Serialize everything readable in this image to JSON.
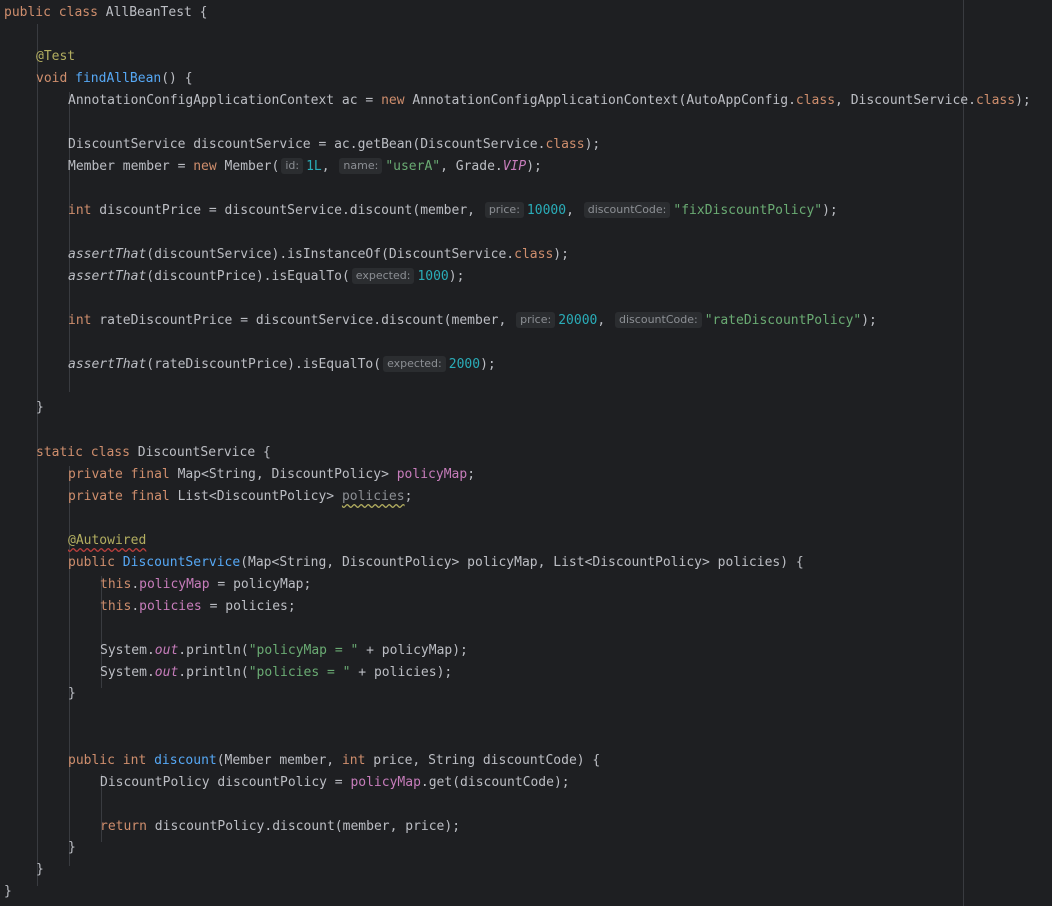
{
  "code": {
    "l1_kw": "public class",
    "l1_name": "AllBeanTest {",
    "l3_ann": "@Test",
    "l4_kw": "void",
    "l4_fn": "findAllBean",
    "l4_rest": "() {",
    "l5_a": "AnnotationConfigApplicationContext ac = ",
    "l5_new": "new",
    "l5_b": " AnnotationConfigApplicationContext(AutoAppConfig.",
    "l5_class1": "class",
    "l5_c": ", DiscountService.",
    "l5_class2": "class",
    "l5_d": ");",
    "l7_a": "DiscountService discountService = ac.getBean(DiscountService.",
    "l7_class": "class",
    "l7_b": ");",
    "l8_a": "Member member = ",
    "l8_new": "new",
    "l8_b": " Member(",
    "l8_hint_id": "id:",
    "l8_id": "1L",
    "l8_comma1": ", ",
    "l8_hint_name": "name:",
    "l8_name": "\"userA\"",
    "l8_c": ", Grade.",
    "l8_vip": "VIP",
    "l8_d": ");",
    "l10_int": "int",
    "l10_a": " discountPrice = discountService.discount(member, ",
    "l10_hint_price": "price:",
    "l10_price": "10000",
    "l10_comma": ", ",
    "l10_hint_code": "discountCode:",
    "l10_code": "\"fixDiscountPolicy\"",
    "l10_b": ");",
    "l12_assert": "assertThat",
    "l12_a": "(discountService).isInstanceOf(DiscountService.",
    "l12_class": "class",
    "l12_b": ");",
    "l13_assert": "assertThat",
    "l13_a": "(discountPrice).isEqualTo(",
    "l13_hint": "expected:",
    "l13_val": "1000",
    "l13_b": ");",
    "l15_int": "int",
    "l15_a": " rateDiscountPrice = discountService.discount(member, ",
    "l15_hint_price": "price:",
    "l15_price": "20000",
    "l15_comma": ", ",
    "l15_hint_code": "discountCode:",
    "l15_code": "\"rateDiscountPolicy\"",
    "l15_b": ");",
    "l17_assert": "assertThat",
    "l17_a": "(rateDiscountPrice).isEqualTo(",
    "l17_hint": "expected:",
    "l17_val": "2000",
    "l17_b": ");",
    "l19": "}",
    "l21_kw": "static class",
    "l21_name": " DiscountService {",
    "l22_kw": "private final",
    "l22_a": " Map<String, DiscountPolicy> ",
    "l22_field": "policyMap",
    "l22_b": ";",
    "l23_kw": "private final",
    "l23_a": " List<DiscountPolicy> ",
    "l23_field": "policies",
    "l23_b": ";",
    "l25_ann": "@Autowired",
    "l26_kw": "public",
    "l26_fn": "DiscountService",
    "l26_a": "(Map<String, DiscountPolicy> policyMap, List<DiscountPolicy> policies) {",
    "l27_this": "this",
    "l27_dot": ".",
    "l27_field": "policyMap",
    "l27_a": " = policyMap;",
    "l28_this": "this",
    "l28_dot": ".",
    "l28_field": "policies",
    "l28_a": " = policies;",
    "l30_a": "System.",
    "l30_out": "out",
    "l30_b": ".println(",
    "l30_str": "\"policyMap = \"",
    "l30_c": " + policyMap);",
    "l31_a": "System.",
    "l31_out": "out",
    "l31_b": ".println(",
    "l31_str": "\"policies = \"",
    "l31_c": " + policies);",
    "l32": "}",
    "l35_kw": "public",
    "l35_int": "int",
    "l35_fn": "discount",
    "l35_a": "(Member member, ",
    "l35_int2": "int",
    "l35_b": " price, String discountCode) {",
    "l36_a": "DiscountPolicy discountPolicy = ",
    "l36_field": "policyMap",
    "l36_b": ".get(discountCode);",
    "l38_ret": "return",
    "l38_a": " discountPolicy.discount(member, price);",
    "l39": "}",
    "l40": "}",
    "l41": "}"
  },
  "colors": {
    "background": "#1e1f22",
    "keyword": "#cf8e6d",
    "annotation": "#b3ae60",
    "function": "#56a8f5",
    "number": "#2aacb8",
    "string": "#6aab73",
    "field": "#c77dbb",
    "text": "#bcbec4"
  }
}
